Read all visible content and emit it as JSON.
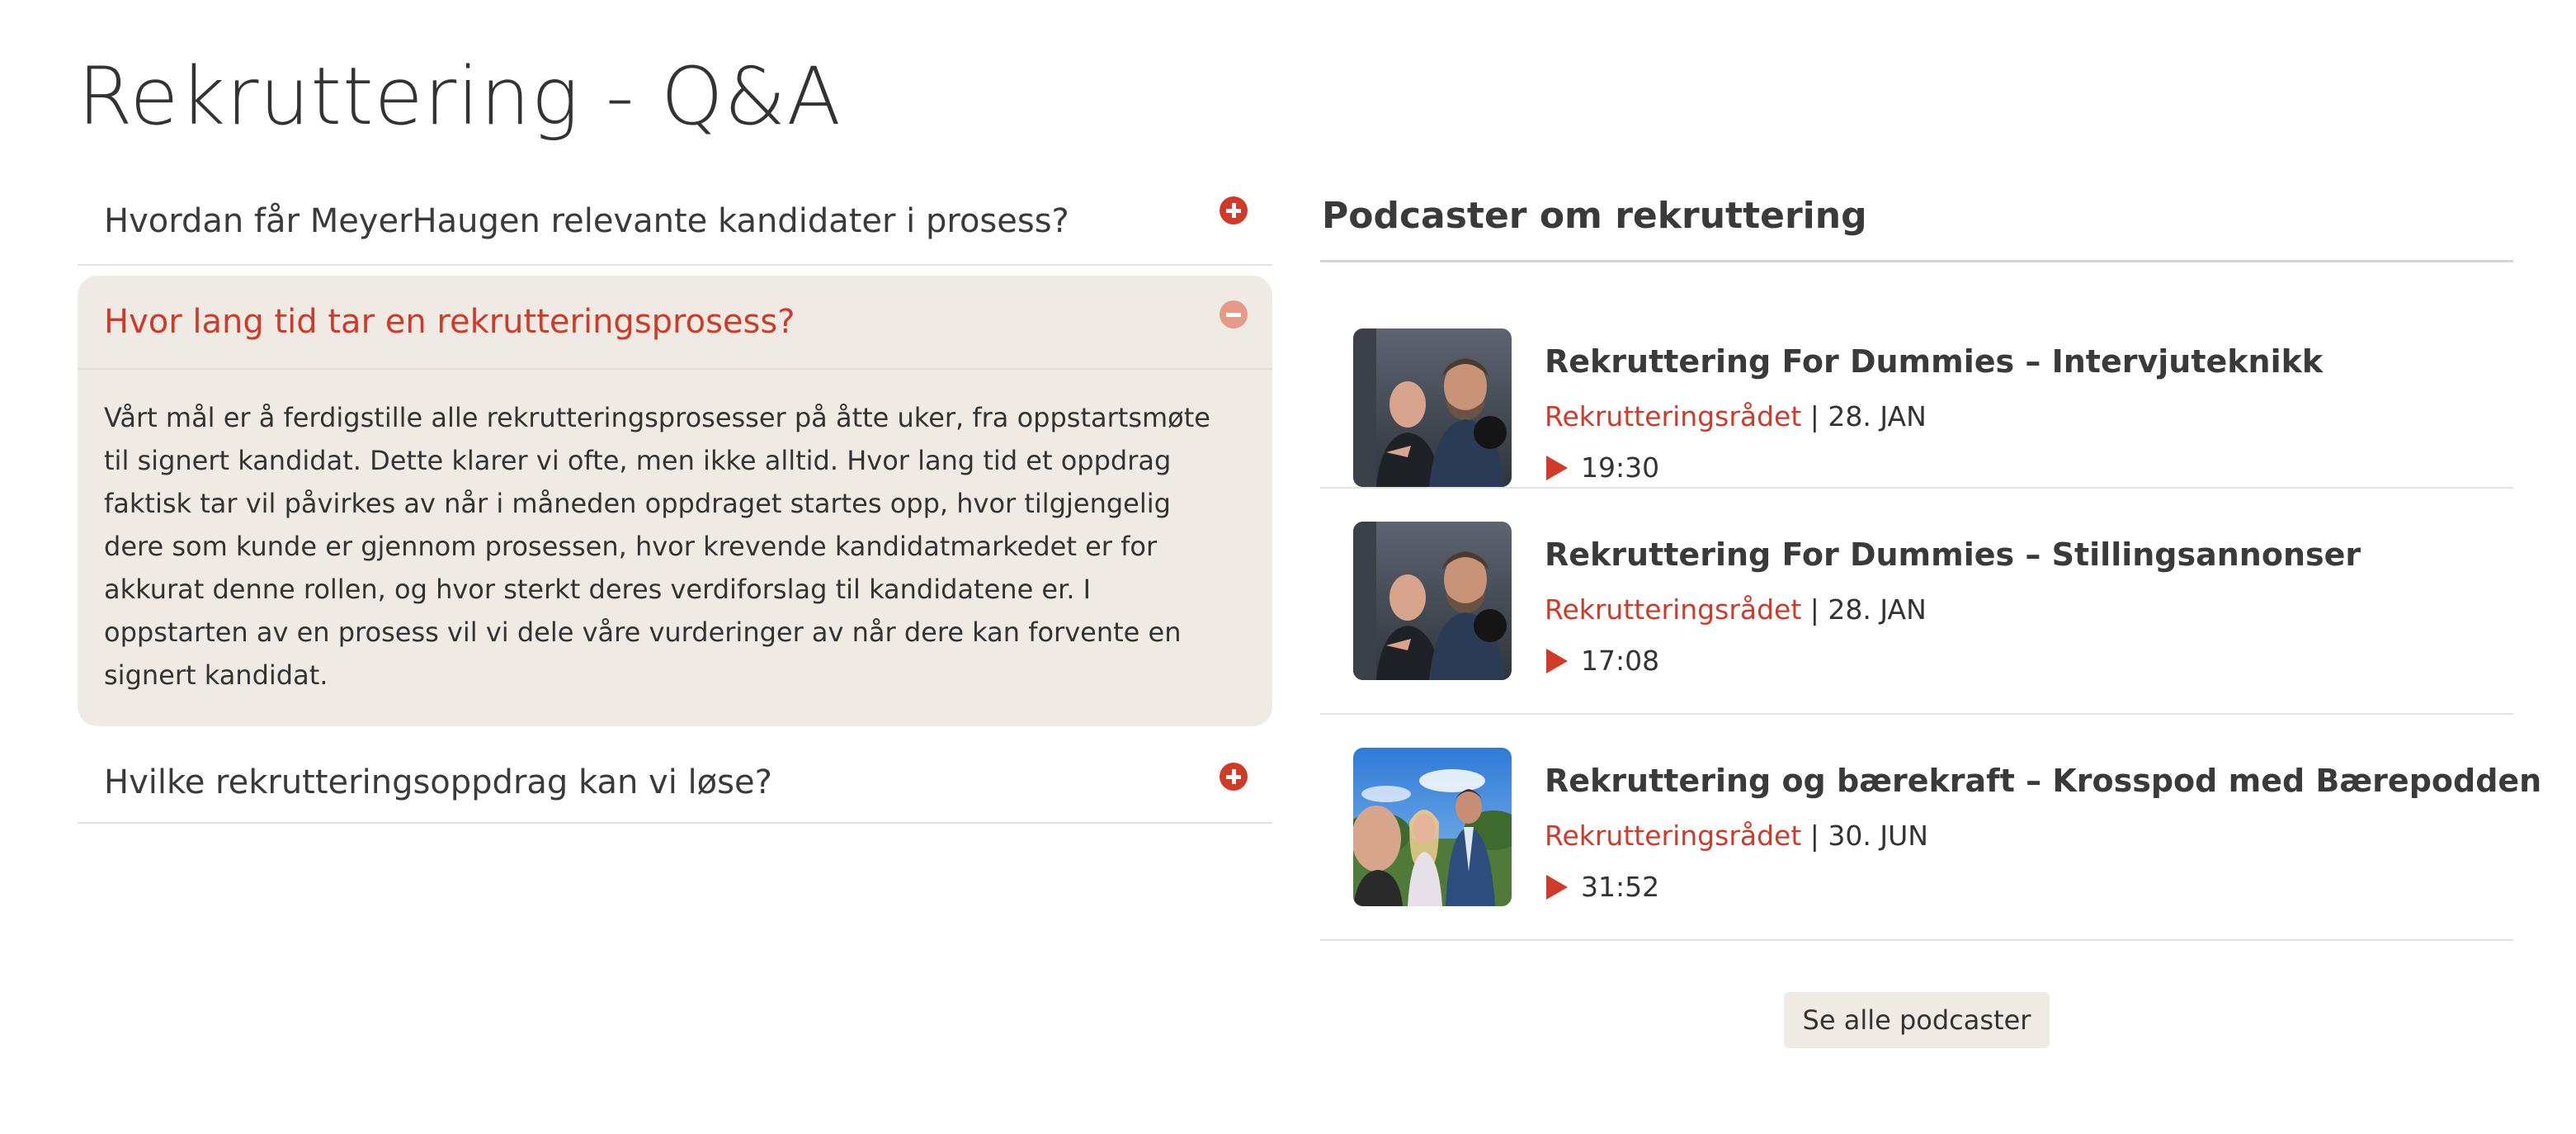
{
  "page": {
    "title": "Rekruttering - Q&A"
  },
  "faq": {
    "items": [
      {
        "question": "Hvordan får MeyerHaugen relevante kandidater i prosess?",
        "expanded": false
      },
      {
        "question": "Hvor lang tid tar en rekrutteringsprosess?",
        "expanded": true,
        "answer": "Vårt mål er å ferdigstille alle rekrutteringsprosesser på åtte uker, fra oppstartsmøte til signert kandidat. Dette klarer vi ofte, men ikke alltid. Hvor lang tid et oppdrag faktisk tar vil påvirkes av når i måneden oppdraget startes opp, hvor tilgjengelig dere som kunde er gjennom prosessen, hvor krevende kandidatmarkedet er for akkurat denne rollen, og hvor sterkt deres verdiforslag til kandidatene er. I oppstarten av en prosess vil vi dele våre vurderinger av når dere kan forvente en signert kandidat."
      },
      {
        "question": "Hvilke rekrutteringsoppdrag kan vi løse?",
        "expanded": false
      }
    ]
  },
  "podcasts": {
    "heading": "Podcaster om rekruttering",
    "episodes": [
      {
        "title": "Rekruttering For Dummies – Intervjuteknikk",
        "author": "Rekrutteringsrådet",
        "separator": " | ",
        "date": "28. JAN",
        "duration": "19:30"
      },
      {
        "title": "Rekruttering For Dummies – Stillingsannonser",
        "author": "Rekrutteringsrådet",
        "separator": " | ",
        "date": "28. JAN",
        "duration": "17:08"
      },
      {
        "title": "Rekruttering og bærekraft – Krosspod med Bærepodden",
        "author": "Rekrutteringsrådet",
        "separator": " | ",
        "date": "30. JUN",
        "duration": "31:52"
      }
    ],
    "see_all_label": "Se alle podcaster"
  },
  "colors": {
    "accent": "#d03a29",
    "accent_light": "#e59a88",
    "panel_bg": "#efebe4",
    "text": "#333333"
  },
  "icons": {
    "expand": "plus-circle-icon",
    "collapse": "minus-circle-icon",
    "play": "play-icon"
  }
}
